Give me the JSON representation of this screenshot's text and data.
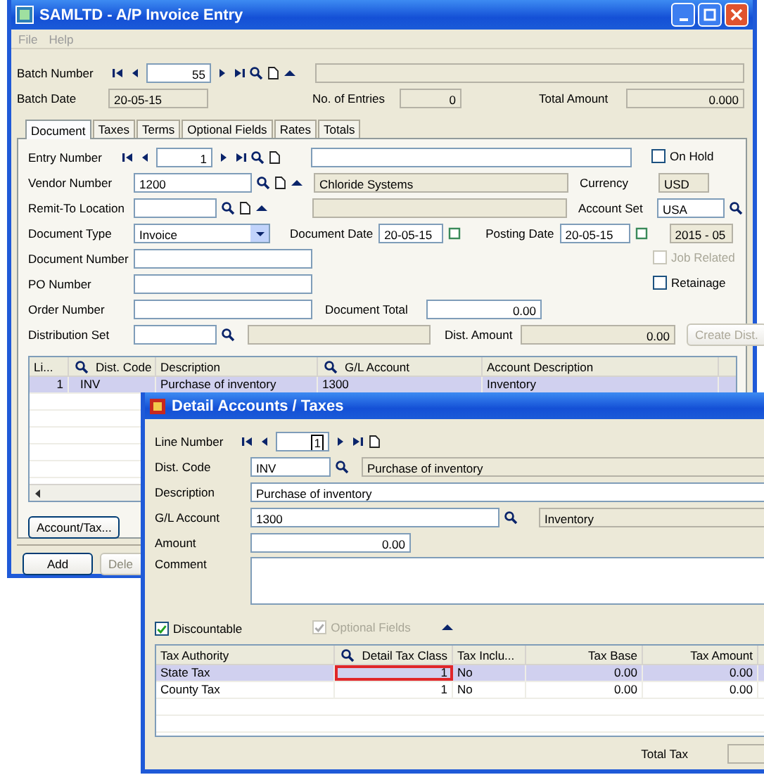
{
  "window": {
    "title": "SAMLTD - A/P Invoice Entry"
  },
  "menu": [
    "File",
    "Help"
  ],
  "batch": {
    "number_label": "Batch Number",
    "number": "55",
    "date_label": "Batch Date",
    "date": "20-05-15",
    "entries_label": "No. of Entries",
    "entries": "0",
    "total_label": "Total Amount",
    "total": "0.000"
  },
  "tabs": [
    {
      "label": "Document",
      "selected": true
    },
    {
      "label": "Taxes",
      "selected": false
    },
    {
      "label": "Terms",
      "selected": false
    },
    {
      "label": "Optional Fields",
      "selected": false
    },
    {
      "label": "Rates",
      "selected": false
    },
    {
      "label": "Totals",
      "selected": false
    }
  ],
  "document": {
    "entry_number": {
      "label": "Entry Number",
      "value": "1"
    },
    "on_hold": {
      "label": "On Hold",
      "checked": false,
      "disabled": false
    },
    "vendor_number": {
      "label": "Vendor Number",
      "value": "1200",
      "name": "Chloride Systems"
    },
    "currency": {
      "label": "Currency",
      "value": "USD"
    },
    "remit_to": {
      "label": "Remit-To Location"
    },
    "account_set": {
      "label": "Account Set",
      "value": "USA"
    },
    "document_type": {
      "label": "Document Type",
      "value": "Invoice"
    },
    "document_date": {
      "label": "Document Date",
      "value": "20-05-15"
    },
    "posting_date": {
      "label": "Posting Date",
      "value": "20-05-15",
      "period": "2015 - 05"
    },
    "document_number": {
      "label": "Document Number"
    },
    "job_related": {
      "label": "Job Related",
      "checked": false,
      "disabled": true
    },
    "po_number": {
      "label": "PO Number"
    },
    "retainage": {
      "label": "Retainage",
      "checked": false,
      "disabled": false
    },
    "order_number": {
      "label": "Order Number"
    },
    "document_total": {
      "label": "Document Total",
      "value": "0.00"
    },
    "distribution_set": {
      "label": "Distribution Set"
    },
    "dist_amount": {
      "label": "Dist. Amount",
      "value": "0.00"
    },
    "create_dist": {
      "label": "Create Dist.",
      "disabled": true
    }
  },
  "grid": {
    "columns": [
      {
        "label": "Li...",
        "lookup": false
      },
      {
        "label": "Dist. Code",
        "lookup": true
      },
      {
        "label": "Description",
        "lookup": false
      },
      {
        "label": "G/L Account",
        "lookup": true
      },
      {
        "label": "Account Description",
        "lookup": false
      }
    ],
    "rows": [
      {
        "cells": [
          "1",
          "INV",
          "Purchase of inventory",
          "1300",
          "Inventory"
        ],
        "selected": true
      }
    ]
  },
  "account_tax_button": "Account/Tax...",
  "add_button": "Add",
  "delete_button": "Dele",
  "dialog": {
    "title": "Detail Accounts / Taxes",
    "line_number": {
      "label": "Line Number",
      "value": "1"
    },
    "dist_code": {
      "label": "Dist. Code",
      "value": "INV",
      "description": "Purchase of inventory"
    },
    "description": {
      "label": "Description",
      "value": "Purchase of inventory"
    },
    "gl_account": {
      "label": "G/L Account",
      "value": "1300",
      "description": "Inventory"
    },
    "amount": {
      "label": "Amount",
      "value": "0.00"
    },
    "comment": {
      "label": "Comment"
    },
    "discountable": {
      "label": "Discountable",
      "checked": true,
      "disabled": false
    },
    "optional_fields": {
      "label": "Optional Fields",
      "checked": true,
      "disabled": true
    },
    "tax_table": {
      "columns": [
        {
          "label": "Tax Authority",
          "lookup": false
        },
        {
          "label": "Detail Tax Class",
          "lookup": true
        },
        {
          "label": "Tax Inclu...",
          "lookup": false
        },
        {
          "label": "Tax Base",
          "lookup": false
        },
        {
          "label": "Tax Amount",
          "lookup": false
        }
      ],
      "rows": [
        {
          "selected": true,
          "cells": [
            {
              "text": "State Tax",
              "outlined": false
            },
            {
              "text": "1",
              "outlined": true
            },
            {
              "text": "No",
              "outlined": false
            },
            {
              "text": "0.00",
              "outlined": false
            },
            {
              "text": "0.00",
              "outlined": false
            }
          ]
        },
        {
          "selected": false,
          "cells": [
            {
              "text": "County Tax",
              "outlined": false
            },
            {
              "text": "1",
              "outlined": false
            },
            {
              "text": "No",
              "outlined": false
            },
            {
              "text": "0.00",
              "outlined": false
            },
            {
              "text": "0.00",
              "outlined": false
            }
          ]
        }
      ]
    },
    "total_tax": {
      "label": "Total Tax"
    }
  }
}
